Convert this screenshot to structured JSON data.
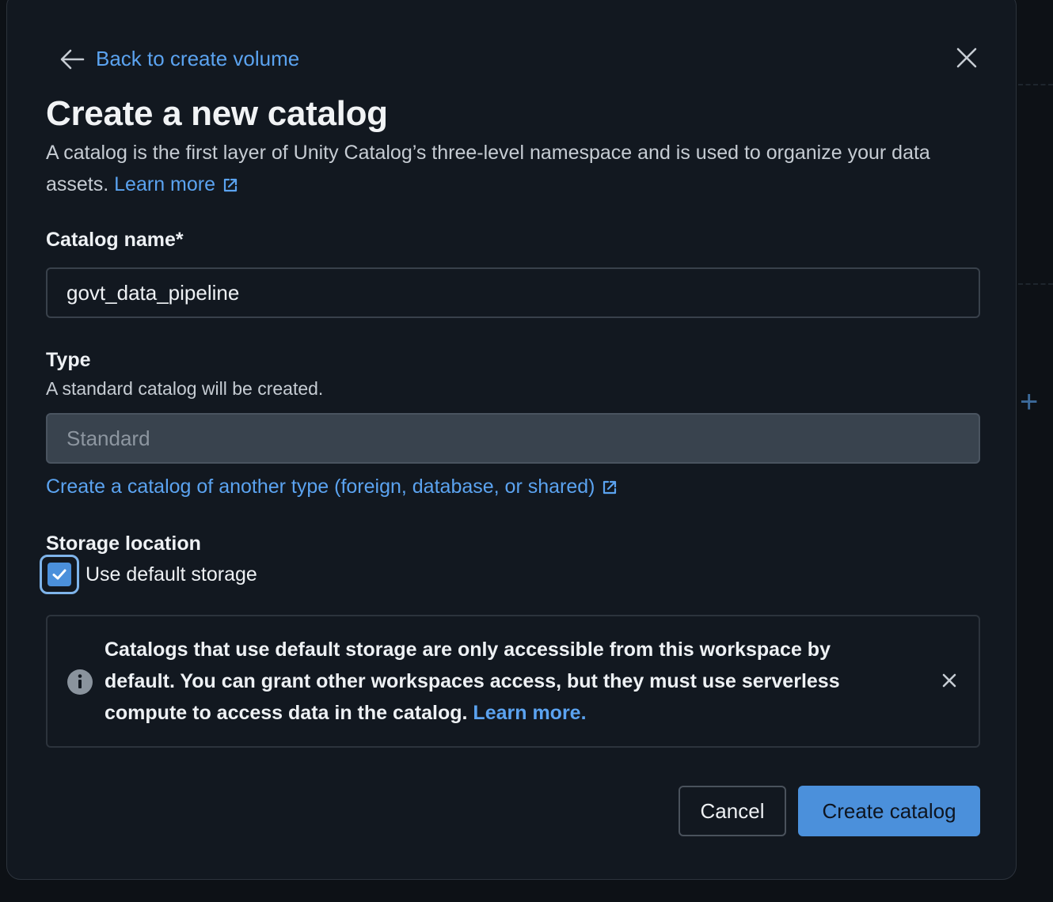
{
  "header": {
    "back_label": "Back to create volume",
    "title": "Create a new catalog",
    "description": "A catalog is the first layer of Unity Catalog’s three-level namespace and is used to organize your data assets.",
    "learn_more": "Learn more"
  },
  "catalog_name": {
    "label": "Catalog name*",
    "value": "govt_data_pipeline"
  },
  "type": {
    "label": "Type",
    "help": "A standard catalog will be created.",
    "placeholder": "Standard",
    "other_type_link": "Create a catalog of another type (foreign, database, or shared)"
  },
  "storage": {
    "label": "Storage location",
    "checkbox_label": "Use default storage",
    "checked": true
  },
  "alert": {
    "text": "Catalogs that use default storage are only accessible from this workspace by default. You can grant other workspaces access, but they must use serverless compute to access data in the catalog.",
    "link": "Learn more."
  },
  "footer": {
    "cancel_label": "Cancel",
    "create_label": "Create catalog"
  },
  "colors": {
    "link": "#5ba3f0",
    "primary": "#4b90db",
    "modal_bg": "#121820"
  }
}
